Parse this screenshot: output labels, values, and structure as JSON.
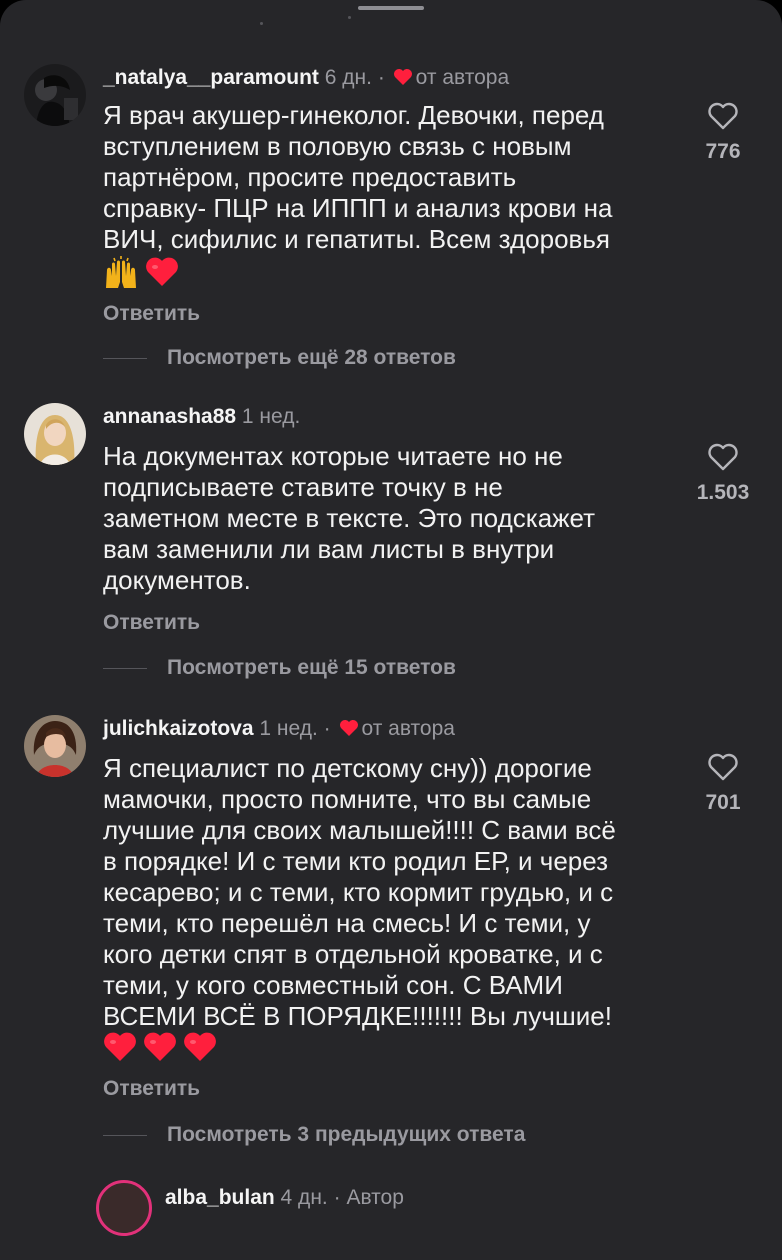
{
  "comments": [
    {
      "username": "_natalya__paramount",
      "time": "6 дн.",
      "separator": "·",
      "author_liked": true,
      "author_label": "от автора",
      "text": "Я врач акушер-гинеколог. Девочки, перед\nвступлением в половую связь с новым\nпартнёром, просите предоставить\nсправку- ПЦР на ИППП и анализ крови на\nВИЧ, сифилис и гепатиты. Всем здоровья",
      "emojis": [
        "raising-hands",
        "red-heart"
      ],
      "reply_label": "Ответить",
      "likes": "776",
      "view_more": "Посмотреть ещё 28 ответов"
    },
    {
      "username": "annanasha88",
      "time": "1 нед.",
      "author_liked": false,
      "text": "На документах которые читаете но не\nподписываете ставите точку в не\nзаметном месте в тексте. Это подскажет\nвам заменили ли вам листы в внутри\nдокументов.",
      "reply_label": "Ответить",
      "likes": "1.503",
      "view_more": "Посмотреть ещё 15 ответов"
    },
    {
      "username": "julichkaizotova",
      "time": "1 нед.",
      "separator": "·",
      "author_liked": true,
      "author_label": "от автора",
      "text": "Я специалист по детскому сну)) дорогие\nмамочки, просто помните, что вы самые\nлучшие для своих малышей!!!! С вами всё\nв порядке! И с теми кто родил ЕР, и через\nкесарево; и с теми, кто кормит грудью, и с\nтеми, кто перешёл на смесь! И с теми, у\nкого детки спят в отдельной кроватке, и с\nтеми, у кого совместный сон. С ВАМИ\nВСЕМИ ВСЁ В ПОРЯДКЕ!!!!!!! Вы лучшие!",
      "emojis": [
        "red-heart",
        "red-heart",
        "red-heart"
      ],
      "reply_label": "Ответить",
      "likes": "701",
      "view_more": "Посмотреть 3 предыдущих ответа"
    }
  ],
  "partial_reply": {
    "username": "alba_bulan",
    "time": "4 дн.",
    "separator": "·",
    "author_label": "Автор"
  },
  "icons": {
    "like": "heart-outline-icon",
    "author_like": "red-heart-icon"
  },
  "colors": {
    "background": "#262629",
    "text": "#f2f2f2",
    "muted": "#9a9aa0",
    "heart": "#ff1f3d"
  }
}
